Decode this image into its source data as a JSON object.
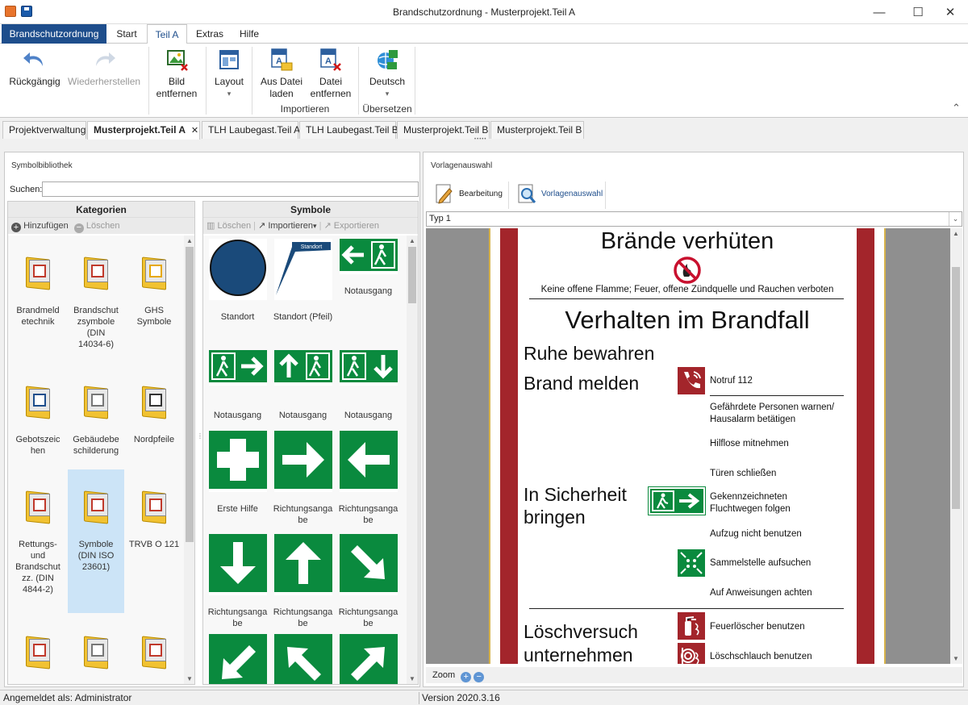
{
  "window": {
    "title": "Brandschutzordnung - Musterprojekt.Teil A",
    "minimize": "—",
    "maximize": "☐",
    "close": "✕"
  },
  "ribbon_tabs": [
    {
      "label": "Brandschutzordnung"
    },
    {
      "label": "Start"
    },
    {
      "label": "Teil A"
    },
    {
      "label": "Extras"
    },
    {
      "label": "Hilfe"
    }
  ],
  "ribbon": {
    "undo": "Rückgängig",
    "redo": "Wiederherstellen",
    "remove_image_1": "Bild",
    "remove_image_2": "entfernen",
    "layout": "Layout",
    "from_file_1": "Aus Datei",
    "from_file_2": "laden",
    "remove_file_1": "Datei",
    "remove_file_2": "entfernen",
    "import_group": "Importieren",
    "language": "Deutsch",
    "translate_group": "Übersetzen",
    "dropdown_arrow": "▾",
    "collapse": "⌃"
  },
  "doc_tabs": [
    {
      "label": "Projektverwaltung"
    },
    {
      "label": "Musterprojekt.Teil A",
      "close": "✕"
    },
    {
      "label": "TLH Laubegast.Teil A"
    },
    {
      "label": "TLH Laubegast.Teil B"
    },
    {
      "label": "Musterprojekt.Teil B"
    },
    {
      "label": "Musterprojekt.Teil B"
    }
  ],
  "splitter_dots": "•••••",
  "left": {
    "panel_title": "Symbolbibliothek",
    "search_label": "Suchen:",
    "search_value": "",
    "categories_header": "Kategorien",
    "add": "Hinzufügen",
    "delete": "Löschen",
    "categories": [
      {
        "l1": "Brandmeld",
        "l2": "etechnik",
        "l3": "",
        "l4": ""
      },
      {
        "l1": "Brandschut",
        "l2": "zsymbole",
        "l3": "(DIN",
        "l4": "14034-6)"
      },
      {
        "l1": "GHS",
        "l2": "Symbole",
        "l3": "",
        "l4": ""
      },
      {
        "l1": "Gebotszeic",
        "l2": "hen",
        "l3": "",
        "l4": ""
      },
      {
        "l1": "Gebäudebe",
        "l2": "schilderung",
        "l3": "",
        "l4": ""
      },
      {
        "l1": "Nordpfeile",
        "l2": "",
        "l3": "",
        "l4": ""
      },
      {
        "l1": "Rettungs-",
        "l2": "und",
        "l3": "Brandschut",
        "l4": "zz. (DIN",
        "l5": "4844-2)"
      },
      {
        "l1": "Symbole",
        "l2": "(DIN ISO",
        "l3": "23601)",
        "l4": ""
      },
      {
        "l1": "TRVB O 121",
        "l2": "",
        "l3": "",
        "l4": ""
      }
    ],
    "symbols_header": "Symbole",
    "sym_delete": "Löschen",
    "sym_import": "Importieren",
    "sym_export": "Exportieren",
    "standort_tag": "Standort",
    "symbols": [
      {
        "l1": "Standort",
        "l2": ""
      },
      {
        "l1": "Standort (Pfeil)",
        "l2": ""
      },
      {
        "l1": "Notausgang",
        "l2": ""
      },
      {
        "l1": "Notausgang",
        "l2": ""
      },
      {
        "l1": "Notausgang",
        "l2": ""
      },
      {
        "l1": "Notausgang",
        "l2": ""
      },
      {
        "l1": "Erste Hilfe",
        "l2": ""
      },
      {
        "l1": "Richtungsanga",
        "l2": "be"
      },
      {
        "l1": "Richtungsanga",
        "l2": "be"
      },
      {
        "l1": "Richtungsanga",
        "l2": "be"
      },
      {
        "l1": "Richtungsanga",
        "l2": "be"
      },
      {
        "l1": "Richtungsanga",
        "l2": "be"
      }
    ]
  },
  "right": {
    "panel_title": "Vorlagenauswahl",
    "edit_btn": "Bearbeitung",
    "select_btn": "Vorlagenauswahl",
    "type_value": "Typ 1",
    "zoom": "Zoom"
  },
  "poster": {
    "title1": "Brände verhüten",
    "sub1": "Keine offene Flamme; Feuer, offene Zündquelle und Rauchen verboten",
    "title2": "Verhalten im Brandfall",
    "h_ruhe": "Ruhe bewahren",
    "h_melden": "Brand melden",
    "notruf": "Notruf 112",
    "gef1": "Gefährdete Personen warnen/",
    "gef2": "Hausalarm betätigen",
    "hilflose": "Hilflose mitnehmen",
    "tueren": "Türen schließen",
    "h_sicher1": "In Sicherheit",
    "h_sicher2": "bringen",
    "flucht1": "Gekennzeichneten",
    "flucht2": "Fluchtwegen folgen",
    "aufzug": "Aufzug nicht benutzen",
    "sammel": "Sammelstelle aufsuchen",
    "anweis": "Auf Anweisungen achten",
    "h_loesch1": "Löschversuch",
    "h_loesch2": "unternehmen",
    "feuerloescher": "Feuerlöscher benutzen",
    "schlauch": "Löschschlauch benutzen"
  },
  "status": {
    "user": "Angemeldet als: Administrator",
    "version": "Version 2020.3.16"
  },
  "colors": {
    "accent": "#1e4e8c",
    "green": "#0a8a3e",
    "poster_red": "#a3252b",
    "selection": "#cce4f7"
  }
}
